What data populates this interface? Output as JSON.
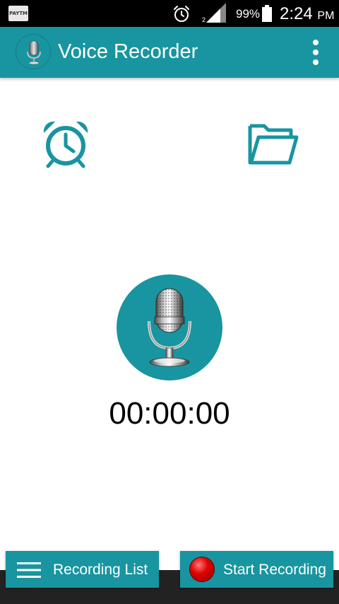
{
  "status_bar": {
    "notification_app": "PAYTM",
    "battery_percent": "99%",
    "time": "2:24",
    "ampm": "PM",
    "icons": [
      "paytm-notification-icon",
      "alarm-icon",
      "signal-icon",
      "battery-icon"
    ]
  },
  "app_bar": {
    "title": "Voice Recorder",
    "logo_icon": "microphone-icon",
    "menu_icon": "more-vert-icon"
  },
  "main": {
    "alarm_icon": "alarm-clock-icon",
    "folder_icon": "folder-icon",
    "record_icon": "microphone-icon",
    "timer": "00:00:00"
  },
  "bottom_bar": {
    "recording_list_label": "Recording List",
    "recording_list_icon": "menu-icon",
    "start_recording_label": "Start Recording",
    "start_recording_icon": "record-dot-icon"
  },
  "colors": {
    "primary": "#1895a0",
    "status_bar": "#000000",
    "background": "#ffffff",
    "record_red": "#e00000"
  }
}
